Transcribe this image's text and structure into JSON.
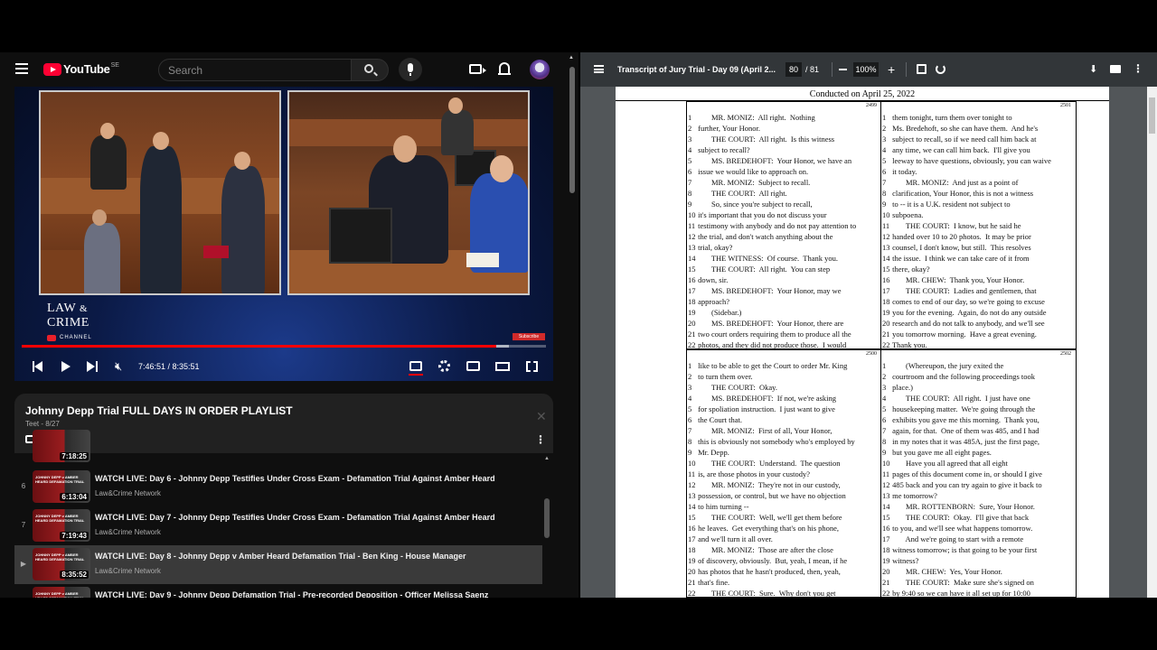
{
  "youtube": {
    "logo_text": "YouTube",
    "logo_country": "SE",
    "search_placeholder": "Search",
    "player": {
      "channel_logo_line1": "LAW",
      "channel_logo_amp": "&",
      "channel_logo_line2": "CRIME",
      "channel_logo_sub": "CHANNEL",
      "subscribe_badge": "Subscribe",
      "time_current": "7:46:51",
      "time_total": "8:35:51",
      "time_display": "7:46:51 / 8:35:51",
      "progress_fraction": 0.905,
      "buffered_fraction": 0.93
    },
    "playlist": {
      "title": "Johnny Depp Trial FULL DAYS IN ORDER PLAYLIST",
      "subtitle": "Teet - 8/27",
      "close_label": "✕",
      "shuffle_glyph": "⤨",
      "menu_glyph": "⋮",
      "partial_duration": "7:18:25",
      "items": [
        {
          "index": "6",
          "title": "WATCH LIVE: Day 6 - Johnny Depp Testifies Under Cross Exam - Defamation Trial Against Amber Heard",
          "channel": "Law&Crime Network",
          "duration": "6:13:04",
          "thumb_text": "JOHNNY DEPP v AMBER HEARD DEFAMATION TRIAL"
        },
        {
          "index": "7",
          "title": "WATCH LIVE: Day 7 - Johnny Depp Testifies Under Cross Exam - Defamation Trial Against Amber Heard",
          "channel": "Law&Crime Network",
          "duration": "7:19:43",
          "thumb_text": "JOHNNY DEPP v AMBER HEARD DEFAMATION TRIAL"
        },
        {
          "index": "▶",
          "title": "WATCH LIVE: Day 8 - Johnny Depp v Amber Heard Defamation Trial - Ben King - House Manager",
          "channel": "Law&Crime Network",
          "duration": "8:35:52",
          "thumb_text": "JOHNNY DEPP v AMBER HEARD DEFAMATION TRIAL",
          "active": true
        },
        {
          "index": "",
          "title": "WATCH LIVE: Day 9 - Johnny Depp Defamation Trial - Pre-recorded Deposition - Officer Melissa Saenz",
          "channel": "",
          "duration": "",
          "thumb_text": "JOHNNY DEPP v AMBER HEARD DEFAMATION TRIAL"
        }
      ]
    }
  },
  "pdf": {
    "title": "Transcript of Jury Trial - Day 09 (April 2...",
    "page_current": "80",
    "page_total": "/ 81",
    "zoom": "100%",
    "header": "Conducted on April 25, 2022",
    "quadrants": [
      {
        "page_no": "2499",
        "lines": [
          [
            "1",
            "        MR. MONIZ:  All right.  Nothing"
          ],
          [
            "2",
            " further, Your Honor."
          ],
          [
            "3",
            "        THE COURT:  All right.  Is this witness"
          ],
          [
            "4",
            " subject to recall?"
          ],
          [
            "5",
            "        MS. BREDEHOFT:  Your Honor, we have an"
          ],
          [
            "6",
            " issue we would like to approach on."
          ],
          [
            "7",
            "        MR. MONIZ:  Subject to recall."
          ],
          [
            "8",
            "        THE COURT:  All right."
          ],
          [
            "9",
            "        So, since you're subject to recall,"
          ],
          [
            "10",
            " it's important that you do not discuss your"
          ],
          [
            "11",
            " testimony with anybody and do not pay attention to"
          ],
          [
            "12",
            " the trial, and don't watch anything about the"
          ],
          [
            "13",
            " trial, okay?"
          ],
          [
            "14",
            "        THE WITNESS:  Of course.  Thank you."
          ],
          [
            "15",
            "        THE COURT:  All right.  You can step"
          ],
          [
            "16",
            " down, sir."
          ],
          [
            "17",
            "        MS. BREDEHOFT:  Your Honor, may we"
          ],
          [
            "18",
            " approach?"
          ],
          [
            "19",
            "        (Sidebar.)"
          ],
          [
            "20",
            "        MS. BREDEHOFT:  Your Honor, there are"
          ],
          [
            "21",
            " two court orders requiring them to produce all the"
          ],
          [
            "22",
            " photos, and they did not produce those.  I would"
          ]
        ]
      },
      {
        "page_no": "2501",
        "lines": [
          [
            "1",
            " them tonight, turn them over tonight to"
          ],
          [
            "2",
            " Ms. Bredehoft, so she can have them.  And he's"
          ],
          [
            "3",
            " subject to recall, so if we need call him back at"
          ],
          [
            "4",
            " any time, we can call him back.  I'll give you"
          ],
          [
            "5",
            " leeway to have questions, obviously, you can waive"
          ],
          [
            "6",
            " it today."
          ],
          [
            "7",
            "        MR. MONIZ:  And just as a point of"
          ],
          [
            "8",
            " clarification, Your Honor, this is not a witness"
          ],
          [
            "9",
            " to -- it is a U.K. resident not subject to"
          ],
          [
            "10",
            " subpoena."
          ],
          [
            "11",
            "        THE COURT:  I know, but he said he"
          ],
          [
            "12",
            " handed over 10 to 20 photos.  It may be prior"
          ],
          [
            "13",
            " counsel, I don't know, but still.  This resolves"
          ],
          [
            "14",
            " the issue.  I think we can take care of it from"
          ],
          [
            "15",
            " there, okay?"
          ],
          [
            "16",
            "        MR. CHEW:  Thank you, Your Honor."
          ],
          [
            "17",
            "        THE COURT:  Ladies and gentlemen, that"
          ],
          [
            "18",
            " comes to end of our day, so we're going to excuse"
          ],
          [
            "19",
            " you for the evening.  Again, do not do any outside"
          ],
          [
            "20",
            " research and do not talk to anybody, and we'll see"
          ],
          [
            "21",
            " you tomorrow morning.  Have a great evening."
          ],
          [
            "22",
            " Thank you."
          ]
        ]
      },
      {
        "page_no": "2500",
        "lines": [
          [
            "1",
            " like to be able to get the Court to order Mr. King"
          ],
          [
            "2",
            " to turn them over."
          ],
          [
            "3",
            "        THE COURT:  Okay."
          ],
          [
            "4",
            "        MS. BREDEHOFT:  If not, we're asking"
          ],
          [
            "5",
            " for spoliation instruction.  I just want to give"
          ],
          [
            "6",
            " the Court that."
          ],
          [
            "7",
            "        MR. MONIZ:  First of all, Your Honor,"
          ],
          [
            "8",
            " this is obviously not somebody who's employed by"
          ],
          [
            "9",
            " Mr. Depp."
          ],
          [
            "10",
            "        THE COURT:  Understand.  The question"
          ],
          [
            "11",
            " is, are those photos in your custody?"
          ],
          [
            "12",
            "        MR. MONIZ:  They're not in our custody,"
          ],
          [
            "13",
            " possession, or control, but we have no objection"
          ],
          [
            "14",
            " to him turning --"
          ],
          [
            "15",
            "        THE COURT:  Well, we'll get them before"
          ],
          [
            "16",
            " he leaves.  Get everything that's on his phone,"
          ],
          [
            "17",
            " and we'll turn it all over."
          ],
          [
            "18",
            "        MR. MONIZ:  Those are after the close"
          ],
          [
            "19",
            " of discovery, obviously.  But, yeah, I mean, if he"
          ],
          [
            "20",
            " has photos that he hasn't produced, then, yeah,"
          ],
          [
            "21",
            " that's fine."
          ],
          [
            "22",
            "        THE COURT:  Sure.  Why don't you get"
          ]
        ]
      },
      {
        "page_no": "2502",
        "lines": [
          [
            "1",
            "        (Whereupon, the jury exited the"
          ],
          [
            "2",
            " courtroom and the following proceedings took"
          ],
          [
            "3",
            " place.)"
          ],
          [
            "4",
            "        THE COURT:  All right.  I just have one"
          ],
          [
            "5",
            " housekeeping matter.  We're going through the"
          ],
          [
            "6",
            " exhibits you gave me this morning.  Thank you,"
          ],
          [
            "7",
            " again, for that.  One of them was 485, and I had"
          ],
          [
            "8",
            " in my notes that it was 485A, just the first page,"
          ],
          [
            "9",
            " but you gave me all eight pages."
          ],
          [
            "10",
            "        Have you all agreed that all eight"
          ],
          [
            "11",
            " pages of this document come in, or should I give"
          ],
          [
            "12",
            " 485 back and you can try again to give it back to"
          ],
          [
            "13",
            " me tomorrow?"
          ],
          [
            "14",
            "        MR. ROTTENBORN:  Sure, Your Honor."
          ],
          [
            "15",
            "        THE COURT:  Okay.  I'll give that back"
          ],
          [
            "16",
            " to you, and we'll see what happens tomorrow."
          ],
          [
            "17",
            "        And we're going to start with a remote"
          ],
          [
            "18",
            " witness tomorrow; is that going to be your first"
          ],
          [
            "19",
            " witness?"
          ],
          [
            "20",
            "        MR. CHEW:  Yes, Your Honor."
          ],
          [
            "21",
            "        THE COURT:  Make sure she's signed on"
          ],
          [
            "22",
            " by 9:40 so we can have it all set up for 10:00"
          ]
        ]
      }
    ]
  }
}
